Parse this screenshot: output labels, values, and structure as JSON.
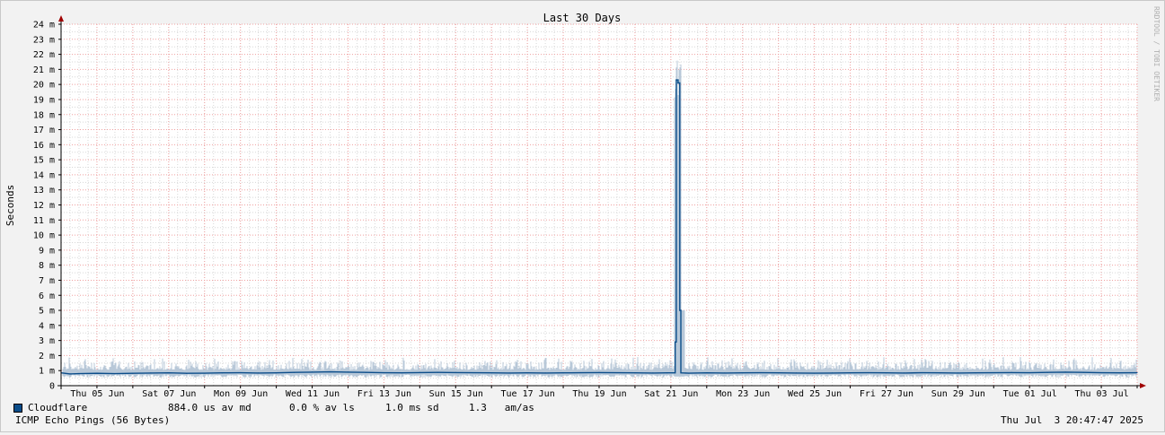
{
  "colors": {
    "line": "#0b4d8a",
    "spread": "#b8c8d8",
    "grid_major": "#f0a0a0",
    "grid_minor": "#d8d8d8",
    "axis_arrow": "#a00000",
    "canvas": "#ffffff",
    "background": "#f2f2f2"
  },
  "watermark": "RRDTOOL / TOBI OETIKER",
  "footer": {
    "subtitle": "ICMP Echo Pings (56 Bytes)",
    "timestamp": "Thu Jul  3 20:47:47 2025"
  },
  "legend": {
    "series_name": "Cloudflare",
    "median": "884.0 us av md",
    "loss": "0.0 % av ls",
    "stddev": "1.0 ms sd",
    "amas": "1.3   am/as"
  },
  "chart_data": {
    "type": "line",
    "title": "Last 30 Days",
    "ylabel": "Seconds",
    "xlabel": "",
    "ylim": [
      0,
      24
    ],
    "y_unit": "m",
    "y_ticks": [
      "0",
      "1 m",
      "2 m",
      "3 m",
      "4 m",
      "5 m",
      "6 m",
      "7 m",
      "8 m",
      "9 m",
      "10 m",
      "11 m",
      "12 m",
      "13 m",
      "14 m",
      "15 m",
      "16 m",
      "17 m",
      "18 m",
      "19 m",
      "20 m",
      "21 m",
      "22 m",
      "23 m",
      "24 m"
    ],
    "x_range_days": [
      0,
      30
    ],
    "x_ticks": [
      {
        "day": 1.0,
        "label": "Thu 05 Jun"
      },
      {
        "day": 3.0,
        "label": "Sat 07 Jun"
      },
      {
        "day": 5.0,
        "label": "Mon 09 Jun"
      },
      {
        "day": 7.0,
        "label": "Wed 11 Jun"
      },
      {
        "day": 9.0,
        "label": "Fri 13 Jun"
      },
      {
        "day": 11.0,
        "label": "Sun 15 Jun"
      },
      {
        "day": 13.0,
        "label": "Tue 17 Jun"
      },
      {
        "day": 15.0,
        "label": "Thu 19 Jun"
      },
      {
        "day": 17.0,
        "label": "Sat 21 Jun"
      },
      {
        "day": 19.0,
        "label": "Mon 23 Jun"
      },
      {
        "day": 21.0,
        "label": "Wed 25 Jun"
      },
      {
        "day": 23.0,
        "label": "Fri 27 Jun"
      },
      {
        "day": 25.0,
        "label": "Sun 29 Jun"
      },
      {
        "day": 27.0,
        "label": "Tue 01 Jul"
      },
      {
        "day": 29.0,
        "label": "Thu 03 Jul"
      }
    ],
    "grid": true,
    "series": [
      {
        "name": "Cloudflare",
        "unit": "ms",
        "points": [
          [
            0.0,
            0.85
          ],
          [
            0.25,
            0.78
          ],
          [
            0.5,
            0.8
          ],
          [
            1.0,
            0.82
          ],
          [
            1.5,
            0.8
          ],
          [
            2.0,
            0.82
          ],
          [
            2.5,
            0.84
          ],
          [
            3.0,
            0.85
          ],
          [
            3.5,
            0.82
          ],
          [
            4.0,
            0.83
          ],
          [
            4.5,
            0.85
          ],
          [
            5.0,
            0.86
          ],
          [
            5.5,
            0.84
          ],
          [
            6.0,
            0.85
          ],
          [
            6.5,
            0.88
          ],
          [
            7.0,
            0.9
          ],
          [
            7.5,
            0.92
          ],
          [
            8.0,
            0.9
          ],
          [
            8.5,
            0.88
          ],
          [
            9.0,
            0.86
          ],
          [
            9.5,
            0.85
          ],
          [
            10.0,
            0.87
          ],
          [
            10.5,
            0.88
          ],
          [
            11.0,
            0.87
          ],
          [
            11.5,
            0.86
          ],
          [
            12.0,
            0.85
          ],
          [
            12.5,
            0.84
          ],
          [
            13.0,
            0.85
          ],
          [
            13.5,
            0.84
          ],
          [
            14.0,
            0.85
          ],
          [
            14.5,
            0.86
          ],
          [
            15.0,
            0.87
          ],
          [
            15.5,
            0.86
          ],
          [
            16.0,
            0.85
          ],
          [
            16.5,
            0.84
          ],
          [
            16.9,
            0.85
          ],
          [
            17.12,
            0.85
          ],
          [
            17.12,
            2.9
          ],
          [
            17.15,
            2.9
          ],
          [
            17.15,
            20.3
          ],
          [
            17.2,
            20.3
          ],
          [
            17.2,
            20.1
          ],
          [
            17.25,
            20.1
          ],
          [
            17.25,
            5.0
          ],
          [
            17.28,
            5.0
          ],
          [
            17.28,
            0.85
          ],
          [
            17.5,
            0.83
          ],
          [
            18.0,
            0.85
          ],
          [
            18.5,
            0.84
          ],
          [
            19.0,
            0.85
          ],
          [
            19.5,
            0.86
          ],
          [
            20.0,
            0.85
          ],
          [
            20.5,
            0.84
          ],
          [
            21.0,
            0.83
          ],
          [
            21.5,
            0.84
          ],
          [
            22.0,
            0.85
          ],
          [
            22.5,
            0.86
          ],
          [
            23.0,
            0.85
          ],
          [
            23.5,
            0.84
          ],
          [
            24.0,
            0.86
          ],
          [
            24.5,
            0.85
          ],
          [
            25.0,
            0.84
          ],
          [
            25.5,
            0.85
          ],
          [
            26.0,
            0.86
          ],
          [
            26.5,
            0.87
          ],
          [
            27.0,
            0.86
          ],
          [
            27.5,
            0.88
          ],
          [
            28.0,
            0.9
          ],
          [
            28.5,
            0.88
          ],
          [
            29.0,
            0.86
          ],
          [
            29.5,
            0.85
          ],
          [
            30.0,
            0.86
          ]
        ]
      }
    ]
  }
}
